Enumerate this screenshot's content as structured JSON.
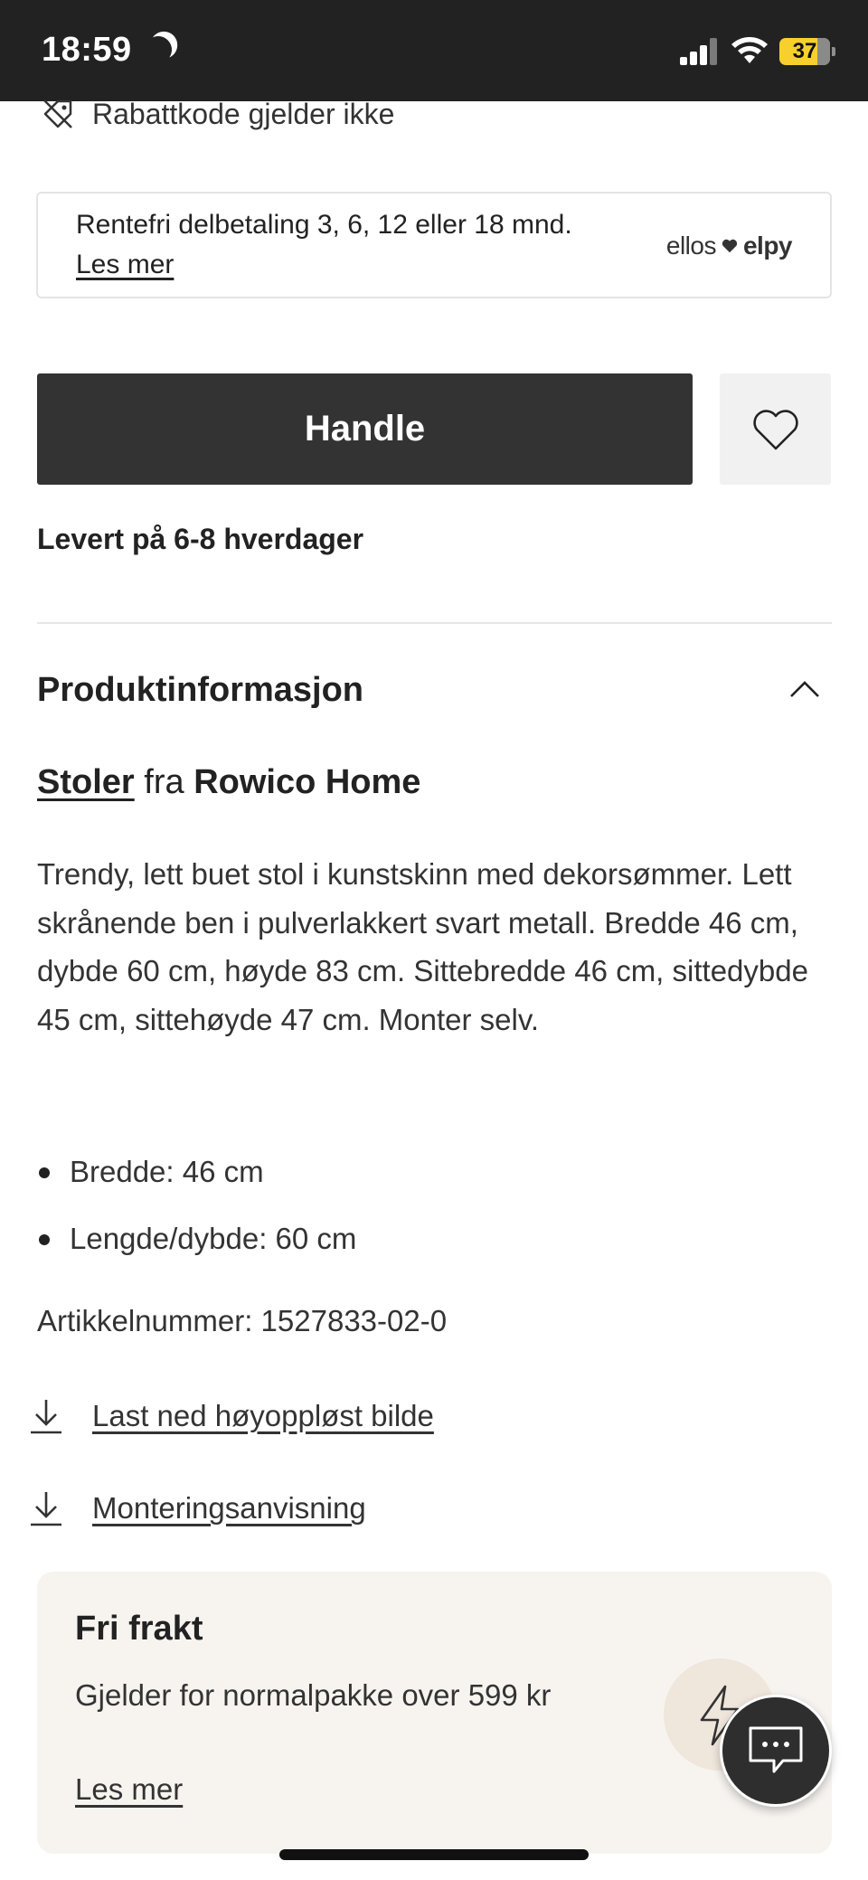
{
  "status_bar": {
    "time": "18:59",
    "battery": "37",
    "icons": [
      "moon-icon",
      "signal-icon",
      "wifi-icon",
      "battery-icon"
    ]
  },
  "discount": {
    "icon": "tag-off-icon",
    "text": "Rabattkode gjelder ikke"
  },
  "installment": {
    "text": "Rentefri delbetaling 3, 6, 12 eller 18 mnd.",
    "link": "Les mer",
    "logo_left": "ellos",
    "logo_right": "elpy"
  },
  "buy": {
    "button_label": "Handle",
    "wishlist_icon": "heart-icon"
  },
  "delivery": "Levert på 6-8 hverdager",
  "product_info": {
    "title": "Produktinformasjon",
    "toggle_icon": "chevron-up-icon",
    "category": "Stoler",
    "from": "fra",
    "brand": "Rowico Home",
    "description": "Trendy, lett buet stol i kunstskinn med dekorsømmer. Lett skrånende ben i pulverlakkert svart metall. Bredde 46 cm, dybde 60 cm, høyde 83 cm. Sittebredde 46 cm, sittedybde 45 cm, sittehøyde 47 cm. Monter selv.",
    "specs": [
      "Bredde: 46 cm",
      "Lengde/dybde: 60 cm"
    ],
    "article_number": "Artikkelnummer: 1527833-02-0",
    "downloads": [
      {
        "label": "Last ned høyoppløst bilde",
        "icon": "download-icon"
      },
      {
        "label": "Monteringsanvisning",
        "icon": "download-icon"
      }
    ]
  },
  "shipping": {
    "title": "Fri frakt",
    "text": "Gjelder for normalpakke over 599 kr",
    "link": "Les mer",
    "icon": "lightning-icon"
  },
  "chat": {
    "icon": "chat-icon"
  },
  "colors": {
    "status_bar_bg": "#222222",
    "primary_button": "#333333",
    "battery": "#f7d02d",
    "shipping_bg": "#f7f4f0"
  }
}
